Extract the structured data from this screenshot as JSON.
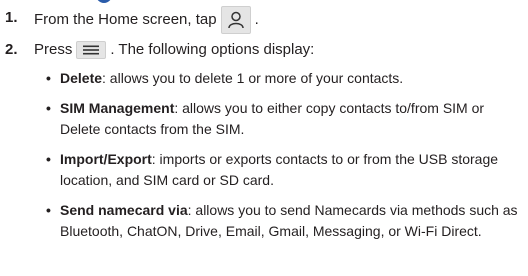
{
  "steps": [
    {
      "number": "1.",
      "text_before": "From the Home screen, tap",
      "text_after": ".",
      "icon": "contacts-person-icon"
    },
    {
      "number": "2.",
      "text_before": "Press",
      "text_after": ". The following options display:",
      "icon": "menu-key-icon"
    }
  ],
  "options": [
    {
      "term": "Delete",
      "desc": ": allows you to delete 1 or more of your contacts."
    },
    {
      "term": "SIM Management",
      "desc": ": allows you to either copy contacts to/from SIM or Delete contacts from the SIM."
    },
    {
      "term": "Import/Export",
      "desc": ": imports or exports contacts to or from the USB storage location, and SIM card or SD card."
    },
    {
      "term": "Send namecard via",
      "desc": ": allows you to send Namecards via methods such as Bluetooth, ChatON, Drive, Email, Gmail, Messaging, or Wi-Fi Direct."
    }
  ],
  "colors": {
    "heading_accent": "#2a5caa",
    "text": "#231f20"
  }
}
